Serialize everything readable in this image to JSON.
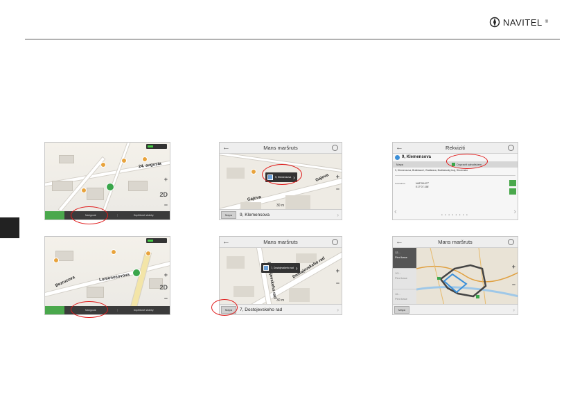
{
  "brand": {
    "name": "NAVITEL",
    "reg": "®"
  },
  "shot1": {
    "streets": [
      "24. augusta"
    ],
    "bottombar": {
      "item1": "Navigovat",
      "item2": "Doplňkové stránky"
    },
    "zoom": {
      "plus": "+",
      "minus": "−",
      "mode": "2D"
    }
  },
  "shot2": {
    "title": "Mans maršruts",
    "popup": "9, Klemensova",
    "streets": [
      "Gajova",
      "Gajova"
    ],
    "scale": "30 m",
    "footer": {
      "button": "Mapa",
      "text": "9, Klemensova"
    }
  },
  "shot3": {
    "title": "Rekviziti",
    "place": "9, Klemensova",
    "btn1": "Mapa",
    "btn2": "Dopravit sahatiskem",
    "address": "9, Klemensova, Bratislava I, Bratislava, Bratislavský kraj, Slovensko",
    "coord_label": "Souřadnice",
    "coord_lat": "N48°08.677'",
    "coord_lon": "E17°07.158'"
  },
  "shot4": {
    "streets": [
      "Lomonosovova",
      "Bezrucova"
    ],
    "bottombar": {
      "item1": "Navigovat",
      "item2": "Doplňkové stránky"
    },
    "zoom": {
      "plus": "+",
      "minus": "−",
      "mode": "2D"
    }
  },
  "shot5": {
    "title": "Mans maršruts",
    "popup": "7, Dostojevskeho rad",
    "streets": [
      "Dostojevskeho rad",
      "Dostojevskeho rad"
    ],
    "scale": "30 m",
    "footer": {
      "button": "Mapa",
      "text": "7, Dostojevskeho rad"
    }
  },
  "shot6": {
    "title": "Mans maršruts",
    "routes": [
      {
        "time": "12...",
        "mode": "Pied base"
      },
      {
        "time": "10/...",
        "mode": "Pied base"
      },
      {
        "time": "16...",
        "mode": "Pied base"
      }
    ],
    "footer": {
      "button": "Mapa"
    }
  },
  "colors": {
    "highlight": "#e01919",
    "accent": "#4aa84c"
  }
}
